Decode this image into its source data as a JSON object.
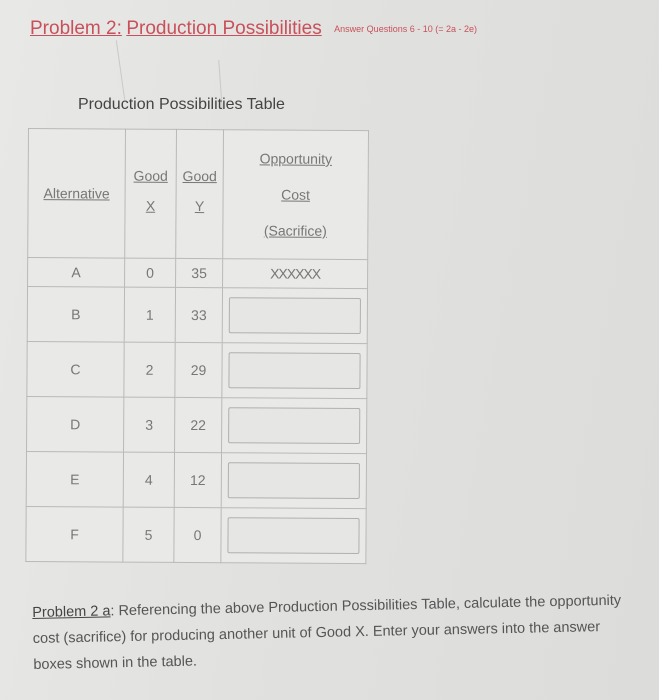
{
  "header": {
    "problem_label": "Problem 2",
    "separator": ":",
    "problem_title": "Production Possibilities",
    "note": "Answer Questions 6 - 10 (= 2a - 2e)"
  },
  "table": {
    "caption": "Production Possibilities Table",
    "columns": {
      "alternative": "Alternative",
      "good_x_top": "Good",
      "good_x_bottom": "X",
      "good_y_top": "Good",
      "good_y_bottom": "Y",
      "oc_line1": "Opportunity",
      "oc_line2": "Cost",
      "oc_line3": "(Sacrifice)"
    },
    "rows": [
      {
        "alternative": "A",
        "x": "0",
        "y": "35",
        "oc": "XXXXXX"
      },
      {
        "alternative": "B",
        "x": "1",
        "y": "33",
        "oc": ""
      },
      {
        "alternative": "C",
        "x": "2",
        "y": "29",
        "oc": ""
      },
      {
        "alternative": "D",
        "x": "3",
        "y": "22",
        "oc": ""
      },
      {
        "alternative": "E",
        "x": "4",
        "y": "12",
        "oc": ""
      },
      {
        "alternative": "F",
        "x": "5",
        "y": "0",
        "oc": ""
      }
    ]
  },
  "problem": {
    "label": "Problem 2 a",
    "colon": ":",
    "text": " Referencing the above Production Possibilities Table, calculate the opportunity cost (sacrifice) for producing another unit of Good X.  Enter your answers into the answer boxes shown in the table."
  }
}
